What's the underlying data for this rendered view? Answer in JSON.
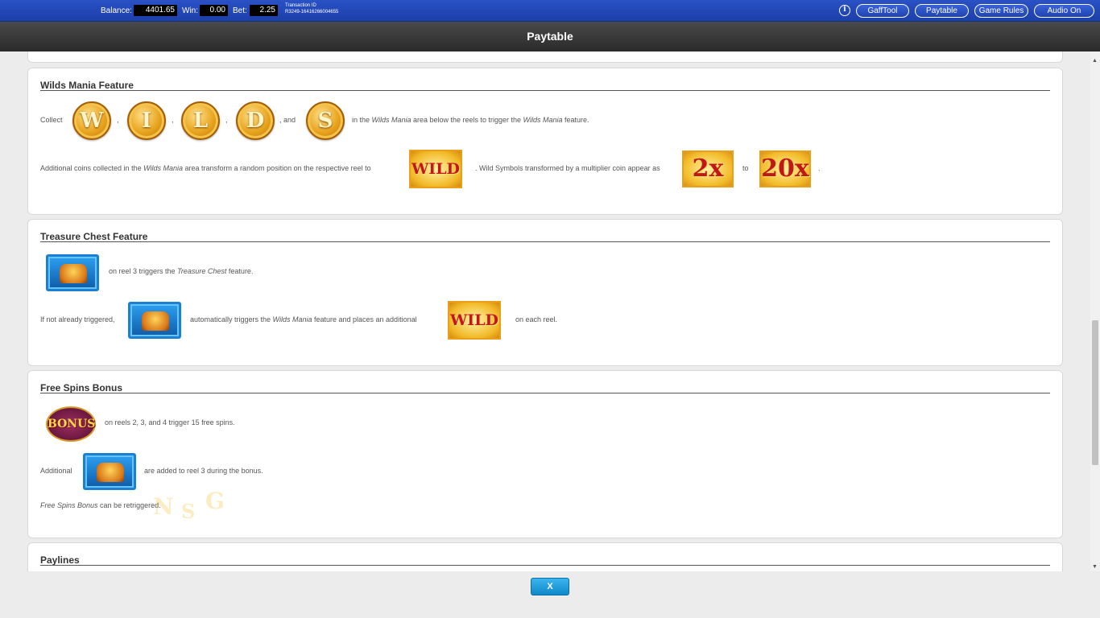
{
  "topbar": {
    "balance_label": "Balance:",
    "balance_value": "4401.65",
    "win_label": "Win:",
    "win_value": "0.00",
    "bet_label": "Bet:",
    "bet_value": "2.25",
    "transaction_label": "Transaction ID",
    "transaction_value": "R3249-16416266004655",
    "info_icon": "info-icon",
    "buttons": [
      "GaffTool",
      "Paytable",
      "Game Rules",
      "Audio On"
    ]
  },
  "header": {
    "title": "Paytable"
  },
  "wilds": {
    "title": "Wilds Mania Feature",
    "collect": "Collect",
    "coins": [
      "W",
      "I",
      "L",
      "D",
      "S"
    ],
    "comma": ",",
    "and": ", and",
    "line1_a": "in the ",
    "line1_em1": "Wilds Mania",
    "line1_b": " area below the reels to trigger the ",
    "line1_em2": "Wilds Mania",
    "line1_c": " feature.",
    "line2_a": "Additional coins collected in the ",
    "line2_em": "Wilds Mania",
    "line2_b": " area transform a random position on the respective reel to",
    "wild_symbol": "WILD",
    "line2_c": ". Wild Symbols transformed by a multiplier coin appear as",
    "mult_low": "2x",
    "to": "to",
    "mult_high": "20x",
    "period": "."
  },
  "treasure": {
    "title": "Treasure Chest Feature",
    "line1_a": "on reel 3 triggers the ",
    "line1_em": "Treasure Chest",
    "line1_b": " feature.",
    "line2_a": "If not already triggered,",
    "line2_b": "automatically triggers the ",
    "line2_em": "Wilds Mania",
    "line2_c": " feature and places an additional",
    "wild_symbol": "WILD",
    "line2_d": "on each reel."
  },
  "freespins": {
    "title": "Free Spins Bonus",
    "bonus_symbol": "BONUS",
    "line1": "on reels 2, 3, and 4 trigger 15 free spins.",
    "line2_a": "Additional",
    "line2_b": "are added to reel 3 during the bonus.",
    "line3_em": "Free Spins Bonus",
    "line3_b": " can be retriggered."
  },
  "paylines": {
    "title": "Paylines"
  },
  "close_label": "X",
  "colors": {
    "topbar": "#2a52c6",
    "header": "#3a3a3a",
    "close_button": "#1f9ad9",
    "wild_text": "#c4161c"
  }
}
